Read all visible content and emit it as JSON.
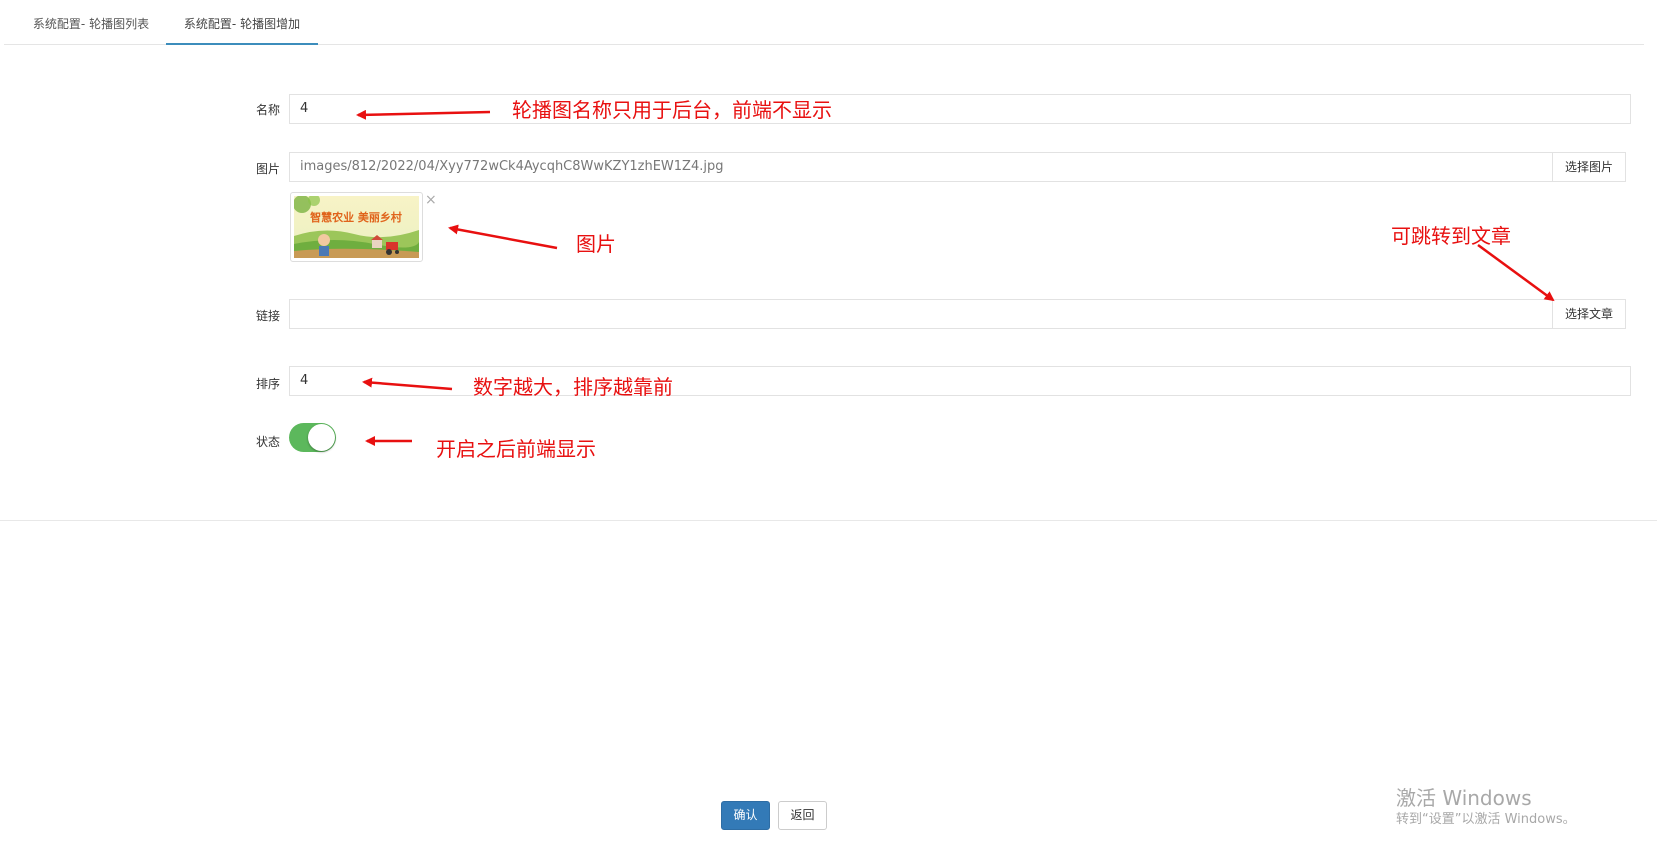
{
  "tabs": [
    {
      "label": "系统配置- 轮播图列表",
      "active": false
    },
    {
      "label": "系统配置- 轮播图增加",
      "active": true
    }
  ],
  "form": {
    "name": {
      "label": "名称",
      "value": "4"
    },
    "image": {
      "label": "图片",
      "value": "images/812/2022/04/Xyy772wCk4AycqhC8WwKZY1zhEW1Z4.jpg",
      "button": "选择图片",
      "remove": "×"
    },
    "link": {
      "label": "链接",
      "value": "",
      "button": "选择文章"
    },
    "sort": {
      "label": "排序",
      "value": "4"
    },
    "status": {
      "label": "状态",
      "enabled": true
    }
  },
  "thumbnail": {
    "banner_text": "智慧农业 美丽乡村"
  },
  "buttons": {
    "confirm": "确认",
    "back": "返回"
  },
  "annotations": {
    "name_note": "轮播图名称只用于后台，前端不显示",
    "image_note": "图片",
    "link_note": "可跳转到文章",
    "sort_note": "数字越大，排序越靠前",
    "status_note": "开启之后前端显示"
  },
  "watermark": {
    "line1": "激活 Windows",
    "line2": "转到“设置”以激活 Windows。"
  },
  "colors": {
    "accent": "#3c8dbc",
    "primary_button": "#337ab7",
    "toggle_on": "#5cb85c",
    "annotation": "#e81010"
  }
}
